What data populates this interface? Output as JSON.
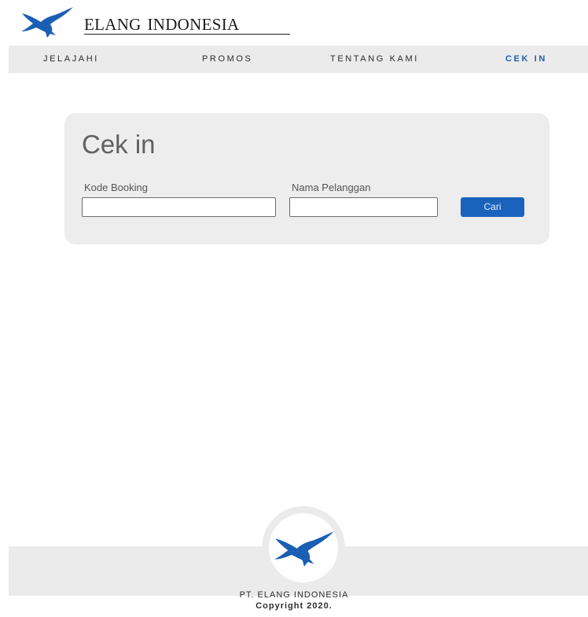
{
  "brand": {
    "name": "Elang Indonesia",
    "logo_icon": "eagle-icon",
    "color": "#1a5fb4"
  },
  "nav": {
    "items": [
      {
        "label": "JELAJAHI",
        "active": false
      },
      {
        "label": "PROMOS",
        "active": false
      },
      {
        "label": "TENTANG KAMI",
        "active": false
      },
      {
        "label": "CEK IN",
        "active": true
      }
    ],
    "active_color": "#1f5fa8"
  },
  "checkin": {
    "title": "Cek in",
    "booking_code": {
      "label": "Kode Booking",
      "value": "",
      "placeholder": ""
    },
    "customer_name": {
      "label": "Nama Pelanggan",
      "value": "",
      "placeholder": ""
    },
    "search_button": "Cari",
    "button_color": "#1a63bd"
  },
  "footer": {
    "company": "PT. ELANG INDONESIA",
    "copyright": "Copyright 2020.",
    "logo_icon": "eagle-icon"
  }
}
